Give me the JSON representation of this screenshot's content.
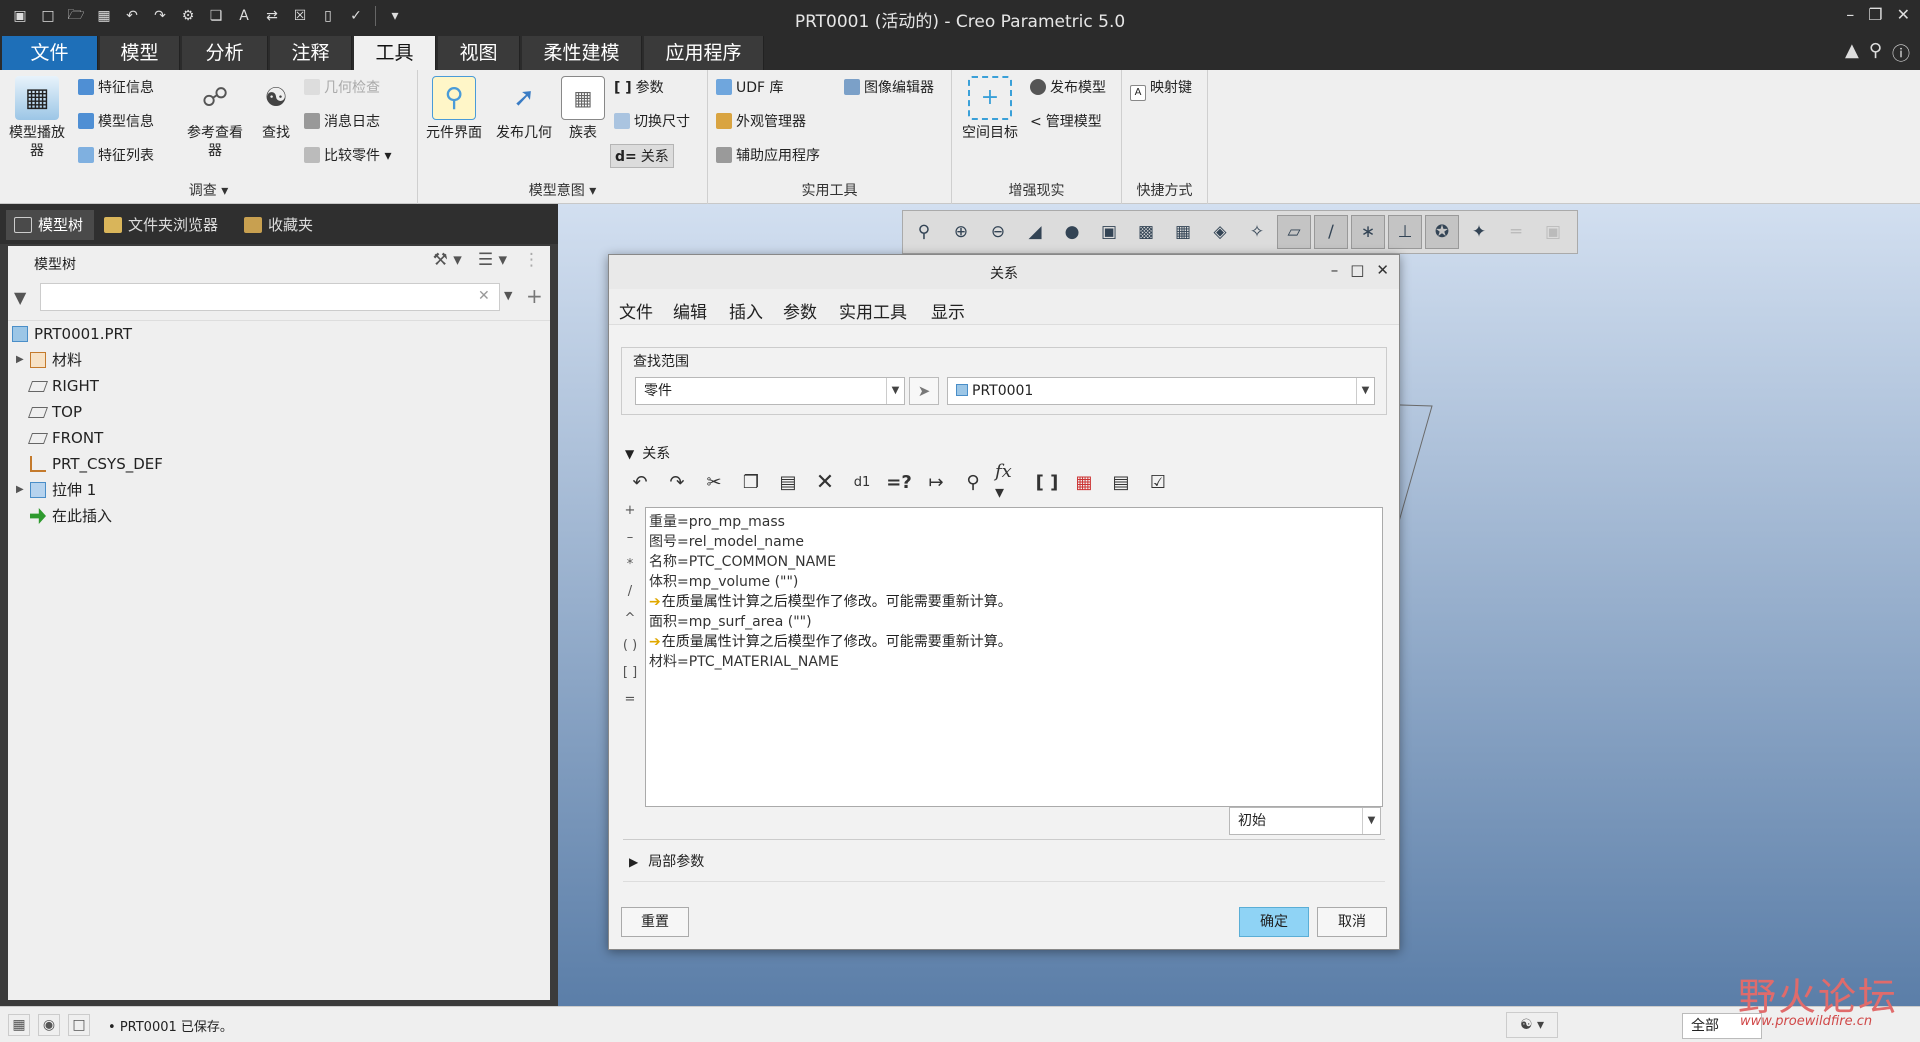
{
  "window": {
    "title": "PRT0001 (活动的) - Creo Parametric 5.0"
  },
  "tabs": [
    "文件",
    "模型",
    "分析",
    "注释",
    "工具",
    "视图",
    "柔性建模",
    "应用程序"
  ],
  "ribbon": {
    "survey": {
      "label": "调查",
      "model_player": "模型播放\n器",
      "feature_info": "特征信息",
      "model_info": "模型信息",
      "feature_list": "特征列表",
      "reference_viewer": "参考查看\n器",
      "find": "查找",
      "geometry_check": "几何检查",
      "message_log": "消息日志",
      "compare_part": "比较零件"
    },
    "model_intent": {
      "label": "模型意图",
      "component_interface": "元件界面",
      "publish_geometry": "发布几何",
      "family_table": "族表",
      "parameters": "参数",
      "switch_dimensions": "切换尺寸",
      "relations": "关系"
    },
    "utilities": {
      "label": "实用工具",
      "udf_library": "UDF 库",
      "appearance_manager": "外观管理器",
      "auxiliary_app": "辅助应用程序",
      "image_editor": "图像编辑器"
    },
    "ar": {
      "label": "增强现实",
      "spatial_target": "空间目标",
      "publish_model": "发布模型",
      "manage_model": "管理模型"
    },
    "shortcuts": {
      "label": "快捷方式",
      "mapkeys": "映射键"
    }
  },
  "left_panel": {
    "tabs": [
      "模型树",
      "文件夹浏览器",
      "收藏夹"
    ],
    "tree_title": "模型树",
    "filter_placeholder": "",
    "tree": [
      {
        "label": "PRT0001.PRT",
        "icon": "part-icon",
        "expandable": false
      },
      {
        "label": "材料",
        "icon": "material-icon",
        "expandable": true
      },
      {
        "label": "RIGHT",
        "icon": "datum-plane-icon",
        "expandable": false
      },
      {
        "label": "TOP",
        "icon": "datum-plane-icon",
        "expandable": false
      },
      {
        "label": "FRONT",
        "icon": "datum-plane-icon",
        "expandable": false
      },
      {
        "label": "PRT_CSYS_DEF",
        "icon": "csys-icon",
        "expandable": false
      },
      {
        "label": "拉伸 1",
        "icon": "extrude-icon",
        "expandable": true
      },
      {
        "label": "在此插入",
        "icon": "insert-here-icon",
        "expandable": false
      }
    ]
  },
  "dialog": {
    "title": "关系",
    "menu": [
      "文件",
      "编辑",
      "插入",
      "参数",
      "实用工具",
      "显示"
    ],
    "scope_label": "查找范围",
    "scope_type": "零件",
    "scope_object": "PRT0001",
    "relations_label": "关系",
    "operators": [
      "+",
      "–",
      "*",
      "/",
      "^",
      "( )",
      "[ ]",
      "="
    ],
    "lines": [
      {
        "text": "重量=pro_mp_mass",
        "warn": false
      },
      {
        "text": "图号=rel_model_name",
        "warn": false
      },
      {
        "text": "名称=PTC_COMMON_NAME",
        "warn": false
      },
      {
        "text": "体积=mp_volume (\"\")",
        "warn": false
      },
      {
        "text": "在质量属性计算之后模型作了修改。可能需要重新计算。",
        "warn": true
      },
      {
        "text": "面积=mp_surf_area (\"\")",
        "warn": false
      },
      {
        "text": "在质量属性计算之后模型作了修改。可能需要重新计算。",
        "warn": true
      },
      {
        "text": "材料=PTC_MATERIAL_NAME",
        "warn": false
      }
    ],
    "initial_value": "初始",
    "local_params_label": "局部参数",
    "reset_label": "重置",
    "ok_label": "确定",
    "cancel_label": "取消"
  },
  "status": {
    "message": "PRT0001 已保存。",
    "filter_value": "全部"
  },
  "watermark": {
    "cn": "野火论坛",
    "url": "www.proewildfire.cn"
  },
  "colors": {
    "titlebar": "#2b2b2b",
    "ribbon": "#efefef",
    "accent": "#8fd3f5",
    "workspace_top": "#d2dff0",
    "workspace_bottom": "#5b7ea8"
  }
}
